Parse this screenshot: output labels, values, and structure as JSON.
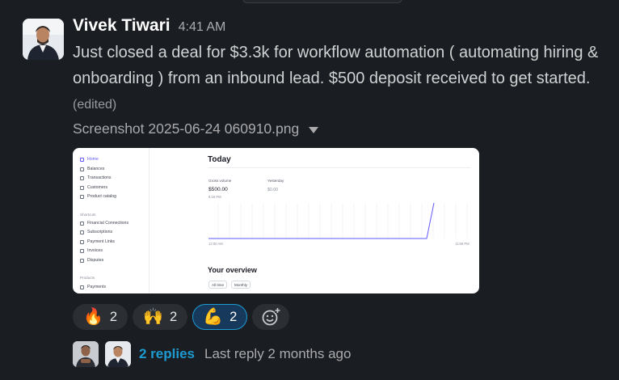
{
  "message": {
    "author": "Vivek Tiwari",
    "time": "4:41 AM",
    "text": "Just closed a deal for $3.3k for workflow automation ( automating hiring & onboarding ) from an inbound lead. $500 deposit received to get started.",
    "edited": "(edited)"
  },
  "attachment": {
    "file_name": "Screenshot 2025-06-24 060910.png",
    "preview": {
      "sidebar": [
        "Home",
        "Balances",
        "Transactions",
        "Customers",
        "Product catalog"
      ],
      "shortcuts_label": "Shortcuts",
      "shortcuts": [
        "Financial Connections",
        "Subscriptions",
        "Payment Links",
        "Invoices",
        "Disputes"
      ],
      "products_label": "Products",
      "products": [
        "Payments"
      ],
      "title": "Today",
      "gross_label": "Gross volume",
      "gross_value": "$500.00",
      "gross_time": "6:18 PM",
      "yesterday_label": "Yesterday",
      "yesterday_value": "$0.00",
      "axis_start": "12:00 AM",
      "axis_end": "11:59 PM",
      "overview_title": "Your overview",
      "filter_all": "All time",
      "filter_period": "Monthly"
    }
  },
  "reactions": [
    {
      "emoji": "🔥",
      "count": "2",
      "selected": false
    },
    {
      "emoji": "🙌",
      "count": "2",
      "selected": false
    },
    {
      "emoji": "💪",
      "count": "2",
      "selected": true
    }
  ],
  "thread": {
    "reply_count": "2 replies",
    "last_reply": "Last reply 2 months ago"
  },
  "colors": {
    "background": "#1a1d21",
    "link": "#1d9bd1",
    "selected_reaction": "#17395b",
    "chart_line": "#625afa"
  }
}
